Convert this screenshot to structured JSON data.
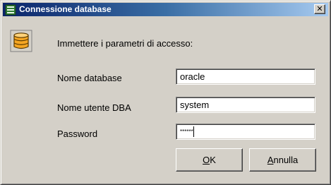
{
  "window": {
    "title": "Connessione database",
    "close_glyph": "✕"
  },
  "prompt": "Immettere i parametri di accesso:",
  "fields": {
    "database": {
      "label": "Nome database",
      "value": "oracle"
    },
    "dba_user": {
      "label": "Nome utente DBA",
      "value": "system"
    },
    "password": {
      "label": "Password",
      "value": "******"
    }
  },
  "buttons": {
    "ok": {
      "hot": "O",
      "rest": "K"
    },
    "cancel": {
      "hot": "A",
      "rest": "nnulla"
    }
  },
  "icons": {
    "app": "database-app-icon",
    "main": "database-icon"
  },
  "colors": {
    "title_gradient_start": "#0a246a",
    "title_gradient_end": "#a6caf0",
    "dialog_face": "#d4d0c8",
    "db_icon": "#f5a623"
  }
}
